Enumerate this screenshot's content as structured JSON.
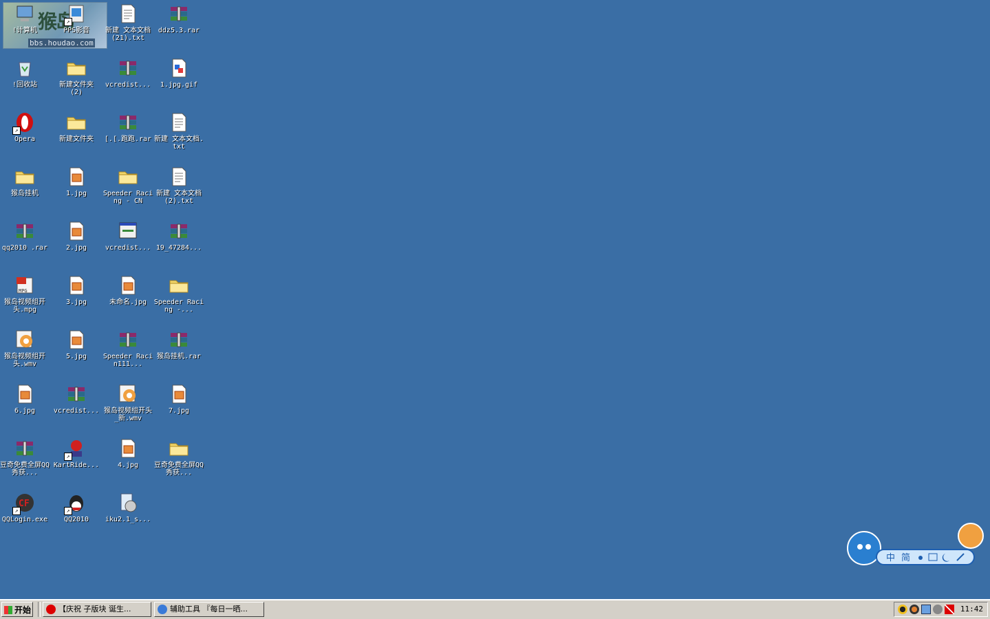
{
  "watermark": {
    "logo_text": "猴岛",
    "url": "bbs.houdao.com"
  },
  "desktop_icons": [
    {
      "label": "!计算机",
      "icon": "computer-icon"
    },
    {
      "label": "PPS影音",
      "icon": "pps-icon"
    },
    {
      "label": "新建 文本文档 (21).txt",
      "icon": "text-file-icon"
    },
    {
      "label": "ddz5.3.rar",
      "icon": "rar-icon"
    },
    {
      "label": "!回收站",
      "icon": "recycle-bin-icon"
    },
    {
      "label": "新建文件夹 (2)",
      "icon": "folder-icon"
    },
    {
      "label": "vcredist...",
      "icon": "rar-icon"
    },
    {
      "label": "1.jpg.gif",
      "icon": "image-file-icon"
    },
    {
      "label": "Opera",
      "icon": "opera-icon"
    },
    {
      "label": "新建文件夹",
      "icon": "folder-icon"
    },
    {
      "label": "[.[.跑跑.rar",
      "icon": "rar-icon"
    },
    {
      "label": "新建 文本文档.txt",
      "icon": "text-file-icon"
    },
    {
      "label": "猴岛挂机",
      "icon": "folder-icon"
    },
    {
      "label": "1.jpg",
      "icon": "jpg-icon"
    },
    {
      "label": "Speeder Racing - CN",
      "icon": "folder-icon"
    },
    {
      "label": "新建 文本文档 (2).txt",
      "icon": "text-file-icon"
    },
    {
      "label": "qq2010 .rar",
      "icon": "rar-icon"
    },
    {
      "label": "2.jpg",
      "icon": "jpg-icon"
    },
    {
      "label": "vcredist...",
      "icon": "installer-icon"
    },
    {
      "label": "19_47284...",
      "icon": "rar-icon"
    },
    {
      "label": "猴岛视频组开头.mpg",
      "icon": "mpg-icon"
    },
    {
      "label": "3.jpg",
      "icon": "jpg-icon"
    },
    {
      "label": "未命名.jpg",
      "icon": "jpg-icon"
    },
    {
      "label": "Speeder Racing -...",
      "icon": "folder-icon"
    },
    {
      "label": "猴岛视频组开头.wmv",
      "icon": "wmv-icon"
    },
    {
      "label": "5.jpg",
      "icon": "jpg-icon"
    },
    {
      "label": "Speeder Racin111...",
      "icon": "rar-icon"
    },
    {
      "label": "猴岛挂机.rar",
      "icon": "rar-icon"
    },
    {
      "label": "6.jpg",
      "icon": "jpg-icon"
    },
    {
      "label": "vcredist...",
      "icon": "rar-icon"
    },
    {
      "label": "猴岛视频组开头_新.wmv",
      "icon": "wmv-icon"
    },
    {
      "label": "7.jpg",
      "icon": "jpg-icon"
    },
    {
      "label": "豆奇免费全屏QQ秀获...",
      "icon": "rar-icon"
    },
    {
      "label": "KartRide...",
      "icon": "kartrider-icon"
    },
    {
      "label": "4.jpg",
      "icon": "jpg-icon"
    },
    {
      "label": "豆奇免费全屏QQ秀获...",
      "icon": "folder-icon"
    },
    {
      "label": "QQLogin.exe",
      "icon": "cf-icon"
    },
    {
      "label": "QQ2010",
      "icon": "qq-icon"
    },
    {
      "label": "iku2.1_s...",
      "icon": "iku-icon"
    }
  ],
  "taskbar": {
    "start_label": "开始",
    "tasks": [
      {
        "label": "【庆祝 子版块 诞生...",
        "icon": "opera-icon"
      },
      {
        "label": "辅助工具 『每日一晒...",
        "icon": "ie-icon"
      }
    ],
    "tray_icons": [
      "qq-icon",
      "qq-group-icon",
      "network-icon",
      "volume-icon",
      "antivirus-icon"
    ],
    "clock": "11:42"
  },
  "ime": {
    "mode": "中",
    "variant": "简"
  }
}
